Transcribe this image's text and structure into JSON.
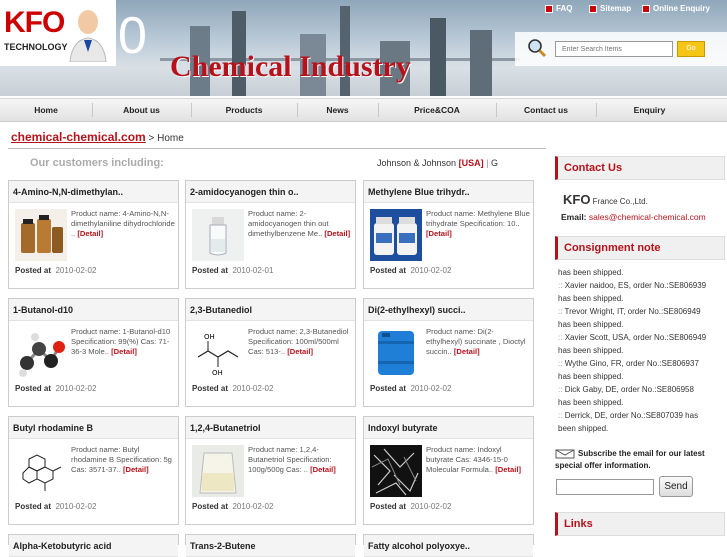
{
  "brand": {
    "logo": "KFO",
    "logo_sub": "TECHNOLOGY",
    "logo_zero": "0",
    "hero_title": "Chemical Industry"
  },
  "top_links": [
    "FAQ",
    "Sitemap",
    "Online Enquiry"
  ],
  "search": {
    "placeholder": "Enter Search Items",
    "button": "Go"
  },
  "nav": [
    "Home",
    "About us",
    "Products",
    "News",
    "Price&COA",
    "Contact us",
    "Enquiry"
  ],
  "breadcrumb": {
    "link": "chemical-chemical.com",
    "rest": " > Home"
  },
  "customers": {
    "label": "Our customers including:",
    "name": "Johnson & Johnson",
    "country": "[USA]",
    "sep": "|",
    "next": "G"
  },
  "posted_label": "Posted at",
  "detail_label": "[Detail]",
  "products": [
    {
      "title": "4-Amino-N,N-dimethylan..",
      "desc": "Product name: 4-Amino-N,N-dimethylaniline dihydrochloride ..",
      "date": "2010-02-02",
      "icon": "brown-bottles-image"
    },
    {
      "title": "2-amidocyanogen thin o..",
      "desc": "Product name: 2-amidocyanogen thin out dimethylbenzene Me..",
      "date": "2010-02-01",
      "icon": "clear-vial-image"
    },
    {
      "title": "Methylene Blue trihydr..",
      "desc": "Product name: Methylene Blue trihydrate Specification: 10..",
      "date": "2010-02-02",
      "icon": "white-jars-image"
    },
    {
      "title": "1-Butanol-d10",
      "desc": "Product name: 1-Butanol-d10 Specification: 99(%) Cas: 71-36-3 Mole..",
      "date": "2010-02-02",
      "icon": "molecule-model-image"
    },
    {
      "title": "2,3-Butanediol",
      "desc": "Product name: 2,3-Butanediol Specification: 100ml/500ml Cas: 513-..",
      "date": "2010-02-02",
      "icon": "structure-formula-image"
    },
    {
      "title": "Di(2-ethylhexyl) succi..",
      "desc": "Product name: Di(2-ethylhexyl) succinate , Dioctyl succin..",
      "date": "2010-02-02",
      "icon": "blue-drum-image"
    },
    {
      "title": "Butyl rhodamine B",
      "desc": "Product name: Butyl rhodamine B Specification: 5g Cas: 3571-37..",
      "date": "2010-02-02",
      "icon": "structure-formula-image"
    },
    {
      "title": "1,2,4-Butanetriol",
      "desc": "Product name: 1,2,4-Butanetriol Specification: 100g/500g Cas: ..",
      "date": "2010-02-02",
      "icon": "clear-vial-image"
    },
    {
      "title": "Indoxyl butyrate",
      "desc": "Product name: Indoxyl butyrate Cas: 4346-15-0 Molecular Formula..",
      "date": "2010-02-02",
      "icon": "dark-crystal-image"
    },
    {
      "title": "Alpha-Ketobutyric acid",
      "desc": "",
      "date": "",
      "icon": ""
    },
    {
      "title": "Trans-2-Butene",
      "desc": "",
      "date": "",
      "icon": ""
    },
    {
      "title": "Fatty alcohol polyoxye..",
      "desc": "",
      "date": "",
      "icon": ""
    }
  ],
  "contact": {
    "heading": "Contact Us",
    "kfo": "KFO",
    "company": " France Co.,Ltd.",
    "email_label": "Email:",
    "email": "sales@chemical-chemical.com"
  },
  "consignment": {
    "heading": "Consignment note",
    "lines": [
      {
        "arrow": "",
        "text": "has been shipped."
      },
      {
        "arrow": "::",
        "text": "Xavier naidoo, ES, order No.:SE806939"
      },
      {
        "arrow": "",
        "text": "has been shipped."
      },
      {
        "arrow": "::",
        "text": "Trevor Wright, IT, order No.:SE806949"
      },
      {
        "arrow": "",
        "text": "has been shipped."
      },
      {
        "arrow": "::",
        "text": "Xavier Scott, USA, order No.:SE806949"
      },
      {
        "arrow": "",
        "text": "has been shipped."
      },
      {
        "arrow": "::",
        "text": "Wythe Gino, FR, order No.:SE806937"
      },
      {
        "arrow": "",
        "text": "has been shipped."
      },
      {
        "arrow": "::",
        "text": "Dick Gaby, DE, order No.:SE806958"
      },
      {
        "arrow": "",
        "text": "has been shipped."
      },
      {
        "arrow": "::",
        "text": "Derrick, DE, order No.:SE807039 has"
      },
      {
        "arrow": "",
        "text": "been shipped."
      }
    ]
  },
  "subscribe": {
    "text": "Subscribe the email for our latest special offer information.",
    "button": "Send",
    "value": ""
  },
  "links_heading": "Links",
  "colors": {
    "accent": "#b5121b",
    "search_button": "#f5c518"
  }
}
